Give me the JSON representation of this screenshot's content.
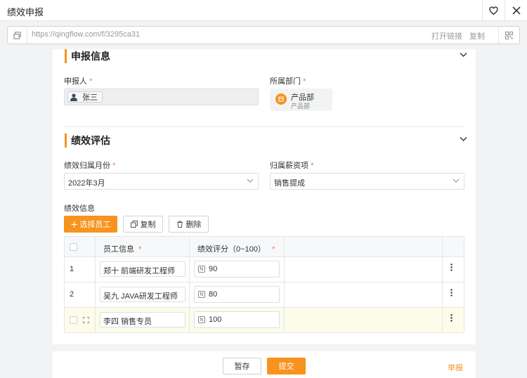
{
  "window": {
    "title": "绩效申报"
  },
  "urlbar": {
    "url": "https://qingflow.com/f/3295ca31",
    "open_link": "打开链接",
    "copy": "复制"
  },
  "sections": {
    "report_info": {
      "title": "申报信息",
      "applicant_label": "申报人",
      "applicant_value": "张三",
      "dept_label": "所属部门",
      "dept_name": "产品部",
      "dept_sub": "产品部"
    },
    "evaluation": {
      "title": "绩效评估",
      "month_label": "绩效归属月份",
      "month_value": "2022年3月",
      "salary_label": "归属薪资项",
      "salary_value": "销售提成",
      "perf_info_label": "绩效信息",
      "btn_select": "选择员工",
      "btn_copy": "复制",
      "btn_delete": "删除",
      "table": {
        "col_employee": "员工信息",
        "col_score": "绩效评分（0~100）",
        "rows": [
          {
            "index": "1",
            "employee": "郑十 前端研发工程师",
            "score": "90"
          },
          {
            "index": "2",
            "employee": "吴九 JAVA研发工程师",
            "score": "80"
          },
          {
            "index": "",
            "employee": "李四 销售专员",
            "score": "100"
          }
        ]
      }
    }
  },
  "required_mark": "*",
  "footer": {
    "save": "暂存",
    "submit": "提交",
    "report": "举报"
  },
  "colors": {
    "accent": "#f7931e",
    "required": "#f56c6c"
  }
}
